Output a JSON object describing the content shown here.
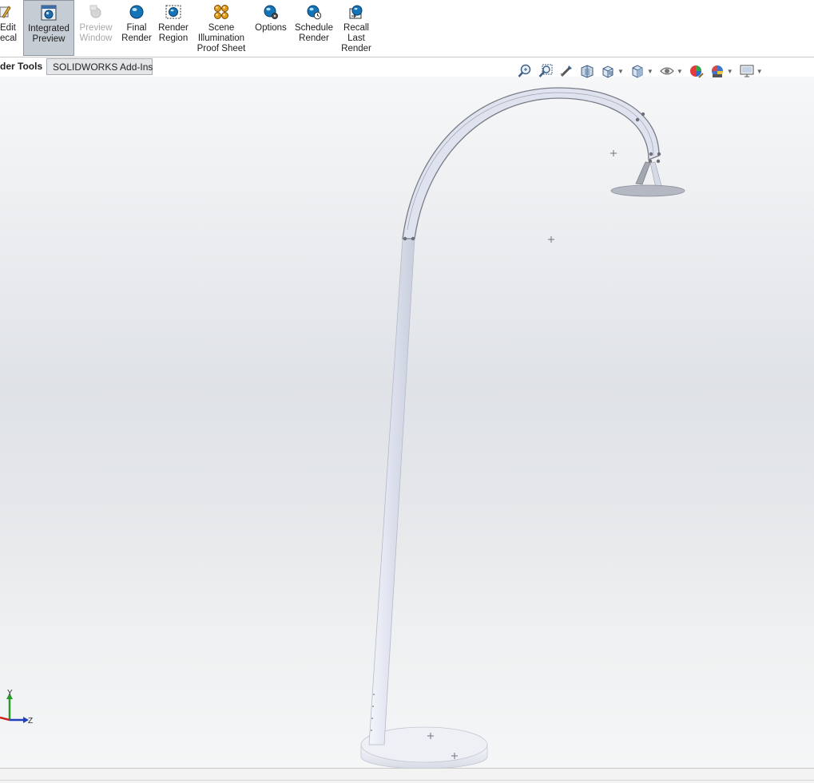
{
  "ribbon": {
    "buttons": [
      {
        "id": "edit-decal",
        "label": "Edit\necal",
        "icon": "edit-decal-icon",
        "state": "normal"
      },
      {
        "id": "integrated-preview",
        "label": "Integrated\nPreview",
        "icon": "integrated-preview-icon",
        "state": "active"
      },
      {
        "id": "preview-window",
        "label": "Preview\nWindow",
        "icon": "preview-window-icon",
        "state": "disabled"
      },
      {
        "id": "final-render",
        "label": "Final\nRender",
        "icon": "final-render-icon",
        "state": "normal"
      },
      {
        "id": "render-region",
        "label": "Render\nRegion",
        "icon": "render-region-icon",
        "state": "normal"
      },
      {
        "id": "scene-illumination",
        "label": "Scene\nIllumination\nProof Sheet",
        "icon": "scene-illumination-icon",
        "state": "normal"
      },
      {
        "id": "options",
        "label": "Options",
        "icon": "options-gear-icon",
        "state": "normal"
      },
      {
        "id": "schedule-render",
        "label": "Schedule\nRender",
        "icon": "schedule-clock-icon",
        "state": "normal"
      },
      {
        "id": "recall-last-render",
        "label": "Recall\nLast\nRender",
        "icon": "recall-render-icon",
        "state": "normal"
      }
    ]
  },
  "tabs": {
    "current": "der Tools",
    "other": "SOLIDWORKS Add-Ins"
  },
  "heads_up_toolbar": {
    "icons": [
      "zoom-to-fit-icon",
      "zoom-to-area-icon",
      "previous-view-icon",
      "section-view-icon",
      "view-orientation-icon",
      "display-style-icon",
      "hide-show-items-icon",
      "edit-appearance-icon",
      "apply-scene-icon",
      "view-settings-icon"
    ]
  },
  "triad": {
    "y_label": "Y",
    "z_label": "Z"
  },
  "colors": {
    "active_button": "#c6ccd3",
    "viewport_top": "#f6f7f8",
    "viewport_mid": "#dfe2e7",
    "model_fill": "#dde1ee",
    "model_edge": "#7a7d86",
    "triad_y": "#2a9a2a",
    "triad_z": "#2040c0",
    "triad_x": "#d02020"
  }
}
